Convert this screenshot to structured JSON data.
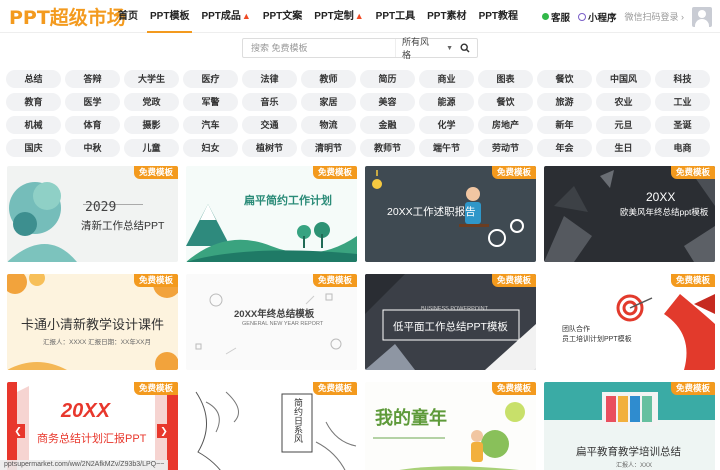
{
  "header": {
    "logo": "PPT超级市场",
    "nav": [
      {
        "label": "首页",
        "hot": false
      },
      {
        "label": "PPT模板",
        "hot": false
      },
      {
        "label": "PPT成品",
        "hot": true
      },
      {
        "label": "PPT文案",
        "hot": false
      },
      {
        "label": "PPT定制",
        "hot": true
      },
      {
        "label": "PPT工具",
        "hot": false
      },
      {
        "label": "PPT素材",
        "hot": false
      },
      {
        "label": "PPT教程",
        "hot": false
      }
    ],
    "service": "客服",
    "mini_program": "小程序",
    "login": "微信扫码登录 ›"
  },
  "search": {
    "placeholder": "搜索 免费模板",
    "style_select": "所有风格"
  },
  "tags": [
    "总结",
    "答辩",
    "大学生",
    "医疗",
    "法律",
    "教师",
    "简历",
    "商业",
    "图表",
    "餐饮",
    "中国风",
    "科技",
    "教育",
    "医学",
    "党政",
    "军警",
    "音乐",
    "家居",
    "美容",
    "能源",
    "餐饮",
    "旅游",
    "农业",
    "工业",
    "机械",
    "体育",
    "摄影",
    "汽车",
    "交通",
    "物流",
    "金融",
    "化学",
    "房地产",
    "新年",
    "元旦",
    "圣诞",
    "国庆",
    "中秋",
    "儿童",
    "妇女",
    "植树节",
    "清明节",
    "教师节",
    "端午节",
    "劳动节",
    "年会",
    "生日",
    "电商"
  ],
  "badge": "免费模板",
  "cards": [
    {
      "title": "2029",
      "subtitle": "清新工作总结PPT"
    },
    {
      "title": "扁平简约工作计划"
    },
    {
      "title": "20XX工作述职报告"
    },
    {
      "title": "20XX",
      "subtitle": "欧美风年终总结ppt模板"
    },
    {
      "title": "卡通小清新教学设计课件",
      "subtitle": "汇报人：XXXX  汇报日期：XX年XX月"
    },
    {
      "title": "20XX年终总结模板",
      "subtitle": "GENERAL NEW YEAR REPORT"
    },
    {
      "title": "低平面工作总结PPT模板",
      "subtitle": "BUSINESS POWERPOINT"
    },
    {
      "title": "团队合作",
      "subtitle": "员工培训计划PPT模板"
    },
    {
      "title": "20XX",
      "subtitle": "商务总结计划汇报PPT"
    },
    {
      "title": "简约日系风"
    },
    {
      "title": "我的童年"
    },
    {
      "title": "扁平教育教学培训总结",
      "subtitle": "汇报人：XXX"
    }
  ],
  "status_url": "pptsupermarket.com/ww/2N2AfkMZv/Z93b3/LPQ~~",
  "colors": {
    "accent": "#f39a1e",
    "hot": "#f04a24"
  }
}
